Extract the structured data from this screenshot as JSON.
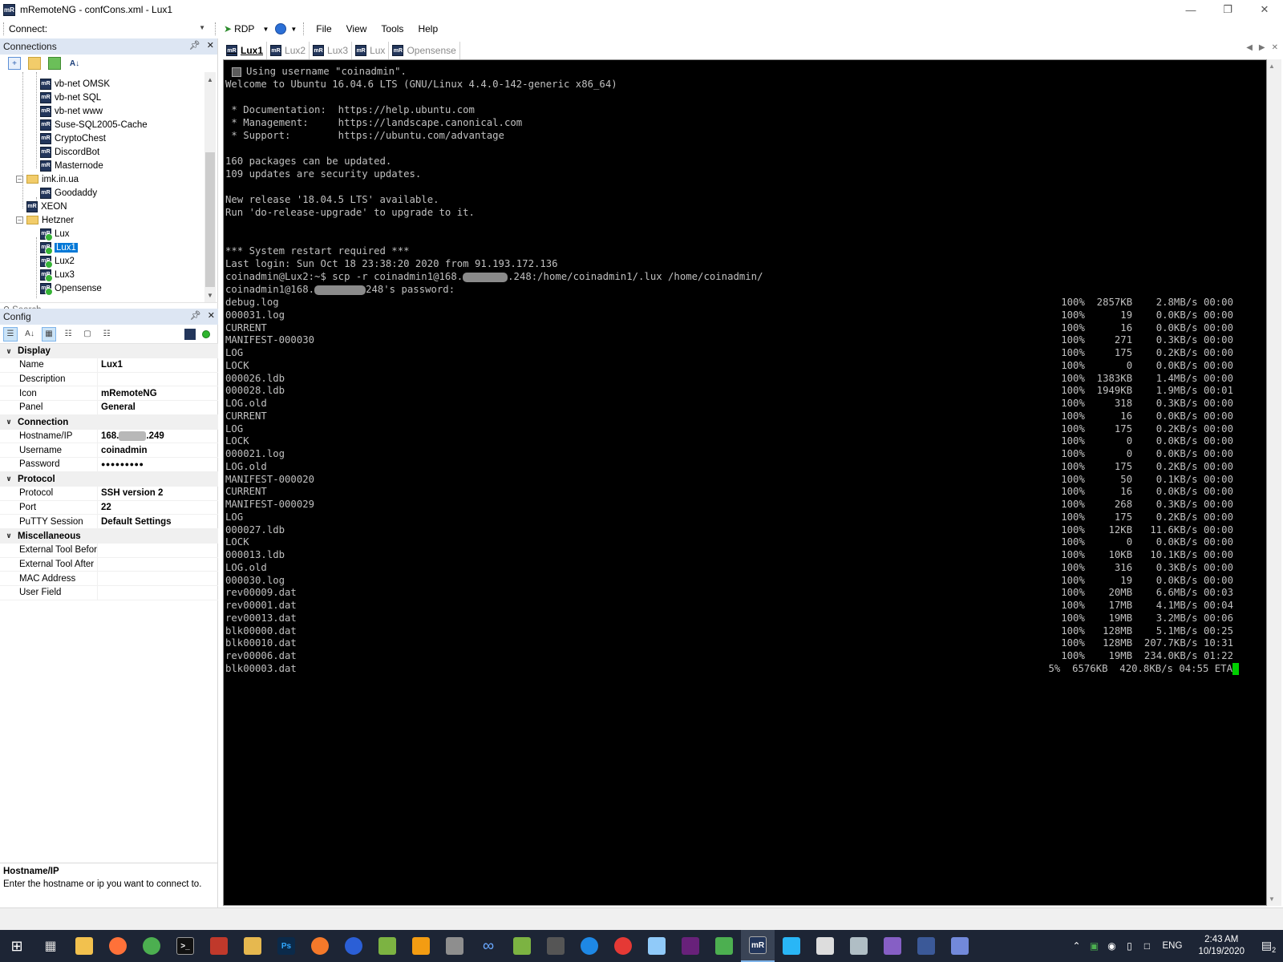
{
  "window": {
    "title": "mRemoteNG - confCons.xml - Lux1",
    "controls": [
      "minimize-icon",
      "restore-icon",
      "close-icon"
    ]
  },
  "toolbar": {
    "connect_label": "Connect:",
    "connect_value": "",
    "rdp_label": "RDP",
    "menus": [
      "File",
      "View",
      "Tools",
      "Help"
    ]
  },
  "connections": {
    "header": "Connections",
    "tree": [
      {
        "label": "vb-net OMSK",
        "type": "connection",
        "level": 2
      },
      {
        "label": "vb-net SQL",
        "type": "connection",
        "level": 2
      },
      {
        "label": "vb-net www",
        "type": "connection",
        "level": 2
      },
      {
        "label": "Suse-SQL2005-Cache",
        "type": "connection",
        "level": 2
      },
      {
        "label": "CryptoChest",
        "type": "connection",
        "level": 2
      },
      {
        "label": "DiscordBot",
        "type": "connection",
        "level": 2
      },
      {
        "label": "Masternode",
        "type": "connection",
        "level": 2
      },
      {
        "label": "imk.in.ua",
        "type": "folder",
        "level": 1
      },
      {
        "label": "Goodaddy",
        "type": "connection",
        "level": 2
      },
      {
        "label": "XEON",
        "type": "connection",
        "level": 1
      },
      {
        "label": "Hetzner",
        "type": "folder",
        "level": 1
      },
      {
        "label": "Lux",
        "type": "connection-open",
        "level": 2
      },
      {
        "label": "Lux1",
        "type": "connection-open",
        "level": 2,
        "selected": true
      },
      {
        "label": "Lux2",
        "type": "connection-open",
        "level": 2
      },
      {
        "label": "Lux3",
        "type": "connection-open",
        "level": 2
      },
      {
        "label": "Opensense",
        "type": "connection-open",
        "level": 2
      }
    ],
    "search_placeholder": "Search"
  },
  "config": {
    "header": "Config",
    "categories": [
      {
        "name": "Display",
        "rows": [
          {
            "name": "Name",
            "value": "Lux1"
          },
          {
            "name": "Description",
            "value": ""
          },
          {
            "name": "Icon",
            "value": "mRemoteNG"
          },
          {
            "name": "Panel",
            "value": "General"
          }
        ]
      },
      {
        "name": "Connection",
        "rows": [
          {
            "name": "Hostname/IP",
            "value_prefix": "168.",
            "value_suffix": ".249",
            "redacted": true
          },
          {
            "name": "Username",
            "value": "coinadmin"
          },
          {
            "name": "Password",
            "value": "●●●●●●●●●"
          }
        ]
      },
      {
        "name": "Protocol",
        "rows": [
          {
            "name": "Protocol",
            "value": "SSH version 2"
          },
          {
            "name": "Port",
            "value": "22"
          },
          {
            "name": "PuTTY Session",
            "value": "Default Settings"
          }
        ]
      },
      {
        "name": "Miscellaneous",
        "rows": [
          {
            "name": "External Tool Before",
            "value": ""
          },
          {
            "name": "External Tool After",
            "value": ""
          },
          {
            "name": "MAC Address",
            "value": ""
          },
          {
            "name": "User Field",
            "value": ""
          }
        ]
      }
    ],
    "description_title": "Hostname/IP",
    "description_text": "Enter the hostname or ip you want to connect to."
  },
  "tabs": [
    {
      "label": "Lux1",
      "active": true
    },
    {
      "label": "Lux2",
      "active": false
    },
    {
      "label": "Lux3",
      "active": false
    },
    {
      "label": "Lux",
      "active": false
    },
    {
      "label": "Opensense",
      "active": false
    }
  ],
  "terminal": {
    "lines": [
      "Using username \"coinadmin\".",
      "Welcome to Ubuntu 16.04.6 LTS (GNU/Linux 4.4.0-142-generic x86_64)",
      "",
      " * Documentation:  https://help.ubuntu.com",
      " * Management:     https://landscape.canonical.com",
      " * Support:        https://ubuntu.com/advantage",
      "",
      "160 packages can be updated.",
      "109 updates are security updates.",
      "",
      "New release '18.04.5 LTS' available.",
      "Run 'do-release-upgrade' to upgrade to it.",
      "",
      "",
      "*** System restart required ***",
      "Last login: Sun Oct 18 23:38:20 2020 from 91.193.172.136"
    ],
    "scp_cmd_prefix": "coinadmin@Lux2:~$ scp -r coinadmin1@168.",
    "scp_cmd_suffix": ".248:/home/coinadmin1/.lux /home/coinadmin/",
    "pw_prefix": "coinadmin1@168.",
    "pw_suffix": "248's password:",
    "files": [
      {
        "name": "debug.log",
        "pct": "100%",
        "size": "2857KB",
        "rate": "2.8MB/s",
        "time": "00:00"
      },
      {
        "name": "000031.log",
        "pct": "100%",
        "size": "19",
        "rate": "0.0KB/s",
        "time": "00:00"
      },
      {
        "name": "CURRENT",
        "pct": "100%",
        "size": "16",
        "rate": "0.0KB/s",
        "time": "00:00"
      },
      {
        "name": "MANIFEST-000030",
        "pct": "100%",
        "size": "271",
        "rate": "0.3KB/s",
        "time": "00:00"
      },
      {
        "name": "LOG",
        "pct": "100%",
        "size": "175",
        "rate": "0.2KB/s",
        "time": "00:00"
      },
      {
        "name": "LOCK",
        "pct": "100%",
        "size": "0",
        "rate": "0.0KB/s",
        "time": "00:00"
      },
      {
        "name": "000026.ldb",
        "pct": "100%",
        "size": "1383KB",
        "rate": "1.4MB/s",
        "time": "00:00"
      },
      {
        "name": "000028.ldb",
        "pct": "100%",
        "size": "1949KB",
        "rate": "1.9MB/s",
        "time": "00:01"
      },
      {
        "name": "LOG.old",
        "pct": "100%",
        "size": "318",
        "rate": "0.3KB/s",
        "time": "00:00"
      },
      {
        "name": "CURRENT",
        "pct": "100%",
        "size": "16",
        "rate": "0.0KB/s",
        "time": "00:00"
      },
      {
        "name": "LOG",
        "pct": "100%",
        "size": "175",
        "rate": "0.2KB/s",
        "time": "00:00"
      },
      {
        "name": "LOCK",
        "pct": "100%",
        "size": "0",
        "rate": "0.0KB/s",
        "time": "00:00"
      },
      {
        "name": "000021.log",
        "pct": "100%",
        "size": "0",
        "rate": "0.0KB/s",
        "time": "00:00"
      },
      {
        "name": "LOG.old",
        "pct": "100%",
        "size": "175",
        "rate": "0.2KB/s",
        "time": "00:00"
      },
      {
        "name": "MANIFEST-000020",
        "pct": "100%",
        "size": "50",
        "rate": "0.1KB/s",
        "time": "00:00"
      },
      {
        "name": "CURRENT",
        "pct": "100%",
        "size": "16",
        "rate": "0.0KB/s",
        "time": "00:00"
      },
      {
        "name": "MANIFEST-000029",
        "pct": "100%",
        "size": "268",
        "rate": "0.3KB/s",
        "time": "00:00"
      },
      {
        "name": "LOG",
        "pct": "100%",
        "size": "175",
        "rate": "0.2KB/s",
        "time": "00:00"
      },
      {
        "name": "000027.ldb",
        "pct": "100%",
        "size": "12KB",
        "rate": "11.6KB/s",
        "time": "00:00"
      },
      {
        "name": "LOCK",
        "pct": "100%",
        "size": "0",
        "rate": "0.0KB/s",
        "time": "00:00"
      },
      {
        "name": "000013.ldb",
        "pct": "100%",
        "size": "10KB",
        "rate": "10.1KB/s",
        "time": "00:00"
      },
      {
        "name": "LOG.old",
        "pct": "100%",
        "size": "316",
        "rate": "0.3KB/s",
        "time": "00:00"
      },
      {
        "name": "000030.log",
        "pct": "100%",
        "size": "19",
        "rate": "0.0KB/s",
        "time": "00:00"
      },
      {
        "name": "rev00009.dat",
        "pct": "100%",
        "size": "20MB",
        "rate": "6.6MB/s",
        "time": "00:03"
      },
      {
        "name": "rev00001.dat",
        "pct": "100%",
        "size": "17MB",
        "rate": "4.1MB/s",
        "time": "00:04"
      },
      {
        "name": "rev00013.dat",
        "pct": "100%",
        "size": "19MB",
        "rate": "3.2MB/s",
        "time": "00:06"
      },
      {
        "name": "blk00000.dat",
        "pct": "100%",
        "size": "128MB",
        "rate": "5.1MB/s",
        "time": "00:25"
      },
      {
        "name": "blk00010.dat",
        "pct": "100%",
        "size": "128MB",
        "rate": "207.7KB/s",
        "time": "10:31"
      },
      {
        "name": "rev00006.dat",
        "pct": "100%",
        "size": "19MB",
        "rate": "234.0KB/s",
        "time": "01:22"
      },
      {
        "name": "blk00003.dat",
        "pct": "5%",
        "size": "6576KB",
        "rate": "420.8KB/s",
        "time": "04:55 ETA"
      }
    ]
  },
  "taskbar": {
    "apps": [
      "start-icon",
      "task-view-icon",
      "file-explorer-icon",
      "firefox-icon",
      "chrome-icon",
      "terminal-icon",
      "save-app-icon",
      "folder-icon",
      "photoshop-icon",
      "blender-icon",
      "app-icon",
      "notepad-icon",
      "app-icon",
      "app-icon",
      "infinity-icon",
      "app-icon",
      "video-icon",
      "app-icon",
      "opera-icon",
      "app-icon",
      "visual-studio-icon",
      "app-icon",
      "mremoteng-icon",
      "app-icon",
      "app-icon",
      "app-icon",
      "visual-studio-icon",
      "app-icon",
      "discord-icon"
    ],
    "photoshop_label": "Ps",
    "lang": "ENG",
    "time": "2:43 AM",
    "date": "10/19/2020",
    "notifications": "2"
  }
}
